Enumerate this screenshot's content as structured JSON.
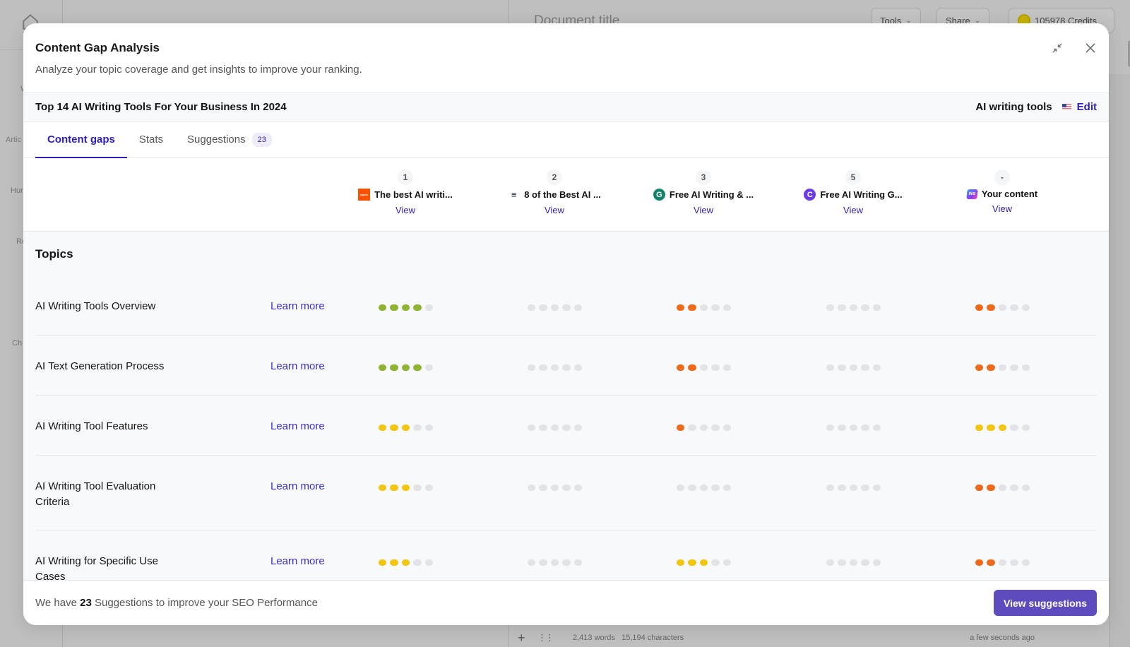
{
  "background": {
    "sidebar_labels": [
      "W",
      "Artic",
      "Hur",
      "Re",
      "Ch"
    ],
    "document_title": "Document title",
    "tools_label": "Tools",
    "share_label": "Share",
    "credits_label": "105978 Credits",
    "word_count": "2,413 words",
    "char_count": "15,194 characters",
    "saved_status": "a few seconds ago"
  },
  "modal": {
    "title": "Content Gap Analysis",
    "subtitle": "Analyze your topic coverage and get insights to improve your ranking.",
    "minimize_icon": "minimize-arrows-icon",
    "close_icon": "close-icon"
  },
  "article": {
    "title": "Top 14 AI Writing Tools For Your Business In 2024",
    "keyword": "AI writing tools",
    "flag_icon": "us-flag-icon",
    "edit_label": "Edit"
  },
  "tabs": [
    {
      "label": "Content gaps",
      "active": true
    },
    {
      "label": "Stats",
      "active": false
    },
    {
      "label": "Suggestions",
      "badge": "23",
      "active": false
    }
  ],
  "competitors": [
    {
      "rank": "1",
      "name": "The best AI writi...",
      "favicon": "zapier-icon",
      "view_label": "View"
    },
    {
      "rank": "2",
      "name": "8 of the Best AI ...",
      "favicon": "layers-icon",
      "view_label": "View"
    },
    {
      "rank": "3",
      "name": "Free AI Writing & ...",
      "favicon": "grammarly-icon",
      "view_label": "View"
    },
    {
      "rank": "5",
      "name": "Free AI Writing G...",
      "favicon": "copyai-icon",
      "view_label": "View"
    },
    {
      "rank": "-",
      "name": "Your content",
      "favicon": "ws-icon",
      "view_label": "View"
    }
  ],
  "topics_heading": "Topics",
  "learn_more_label": "Learn more",
  "score_colors": {
    "green": "#8db330",
    "yellow": "#f2c511",
    "orange": "#ee6a1a",
    "empty": "#e2e3e7"
  },
  "score_max": 5,
  "topics": [
    {
      "name": "AI Writing Tools Overview",
      "scores": [
        {
          "filled": 4,
          "color": "green"
        },
        {
          "filled": 0,
          "color": "empty"
        },
        {
          "filled": 2,
          "color": "orange"
        },
        {
          "filled": 0,
          "color": "empty"
        },
        {
          "filled": 2,
          "color": "orange"
        }
      ]
    },
    {
      "name": "AI Text Generation Process",
      "scores": [
        {
          "filled": 4,
          "color": "green"
        },
        {
          "filled": 0,
          "color": "empty"
        },
        {
          "filled": 2,
          "color": "orange"
        },
        {
          "filled": 0,
          "color": "empty"
        },
        {
          "filled": 2,
          "color": "orange"
        }
      ]
    },
    {
      "name": "AI Writing Tool Features",
      "scores": [
        {
          "filled": 3,
          "color": "yellow"
        },
        {
          "filled": 0,
          "color": "empty"
        },
        {
          "filled": 1,
          "color": "orange"
        },
        {
          "filled": 0,
          "color": "empty"
        },
        {
          "filled": 3,
          "color": "yellow"
        }
      ]
    },
    {
      "name": "AI Writing Tool Evaluation Criteria",
      "scores": [
        {
          "filled": 3,
          "color": "yellow"
        },
        {
          "filled": 0,
          "color": "empty"
        },
        {
          "filled": 0,
          "color": "empty"
        },
        {
          "filled": 0,
          "color": "empty"
        },
        {
          "filled": 2,
          "color": "orange"
        }
      ]
    },
    {
      "name": "AI Writing for Specific Use Cases",
      "scores": [
        {
          "filled": 3,
          "color": "yellow"
        },
        {
          "filled": 0,
          "color": "empty"
        },
        {
          "filled": 3,
          "color": "yellow"
        },
        {
          "filled": 0,
          "color": "empty"
        },
        {
          "filled": 2,
          "color": "orange"
        }
      ]
    }
  ],
  "footer": {
    "text_prefix": "We have",
    "count": "23",
    "text_suffix": "Suggestions to improve your SEO Performance",
    "button_label": "View suggestions"
  }
}
